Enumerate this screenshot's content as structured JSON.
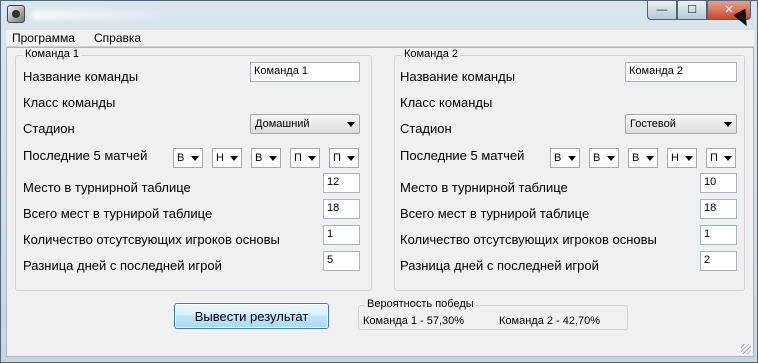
{
  "menu": {
    "program": "Программа",
    "help": "Справка"
  },
  "window_controls": {
    "minimize": "—",
    "maximize": "☐",
    "close": "✕"
  },
  "labels": {
    "team_name": "Название команды",
    "team_class": "Класс команды",
    "stadium": "Стадион",
    "last5": "Последние 5 матчей",
    "table_place": "Место в турнирной таблице",
    "total_places": "Всего мест в турнирой таблице",
    "absent_players": "Количество отсутсвующих игроков основы",
    "days_diff": "Разница дней с последней игрой"
  },
  "team1": {
    "group_title": "Команда 1",
    "name_value": "Команда 1",
    "stadium_value": "Домашний",
    "last5": [
      "В",
      "Н",
      "В",
      "П",
      "П"
    ],
    "place": "12",
    "total": "18",
    "absent": "1",
    "days": "5"
  },
  "team2": {
    "group_title": "Команда 2",
    "name_value": "Команда 2",
    "stadium_value": "Гостевой",
    "last5": [
      "В",
      "В",
      "В",
      "Н",
      "П"
    ],
    "place": "10",
    "total": "18",
    "absent": "1",
    "days": "2"
  },
  "result": {
    "button_label": "Вывести результат",
    "group_title": "Вероятность победы",
    "team1_result": "Команда 1 - 57,30%",
    "team2_result": "Команда 2 - 42,70%"
  }
}
